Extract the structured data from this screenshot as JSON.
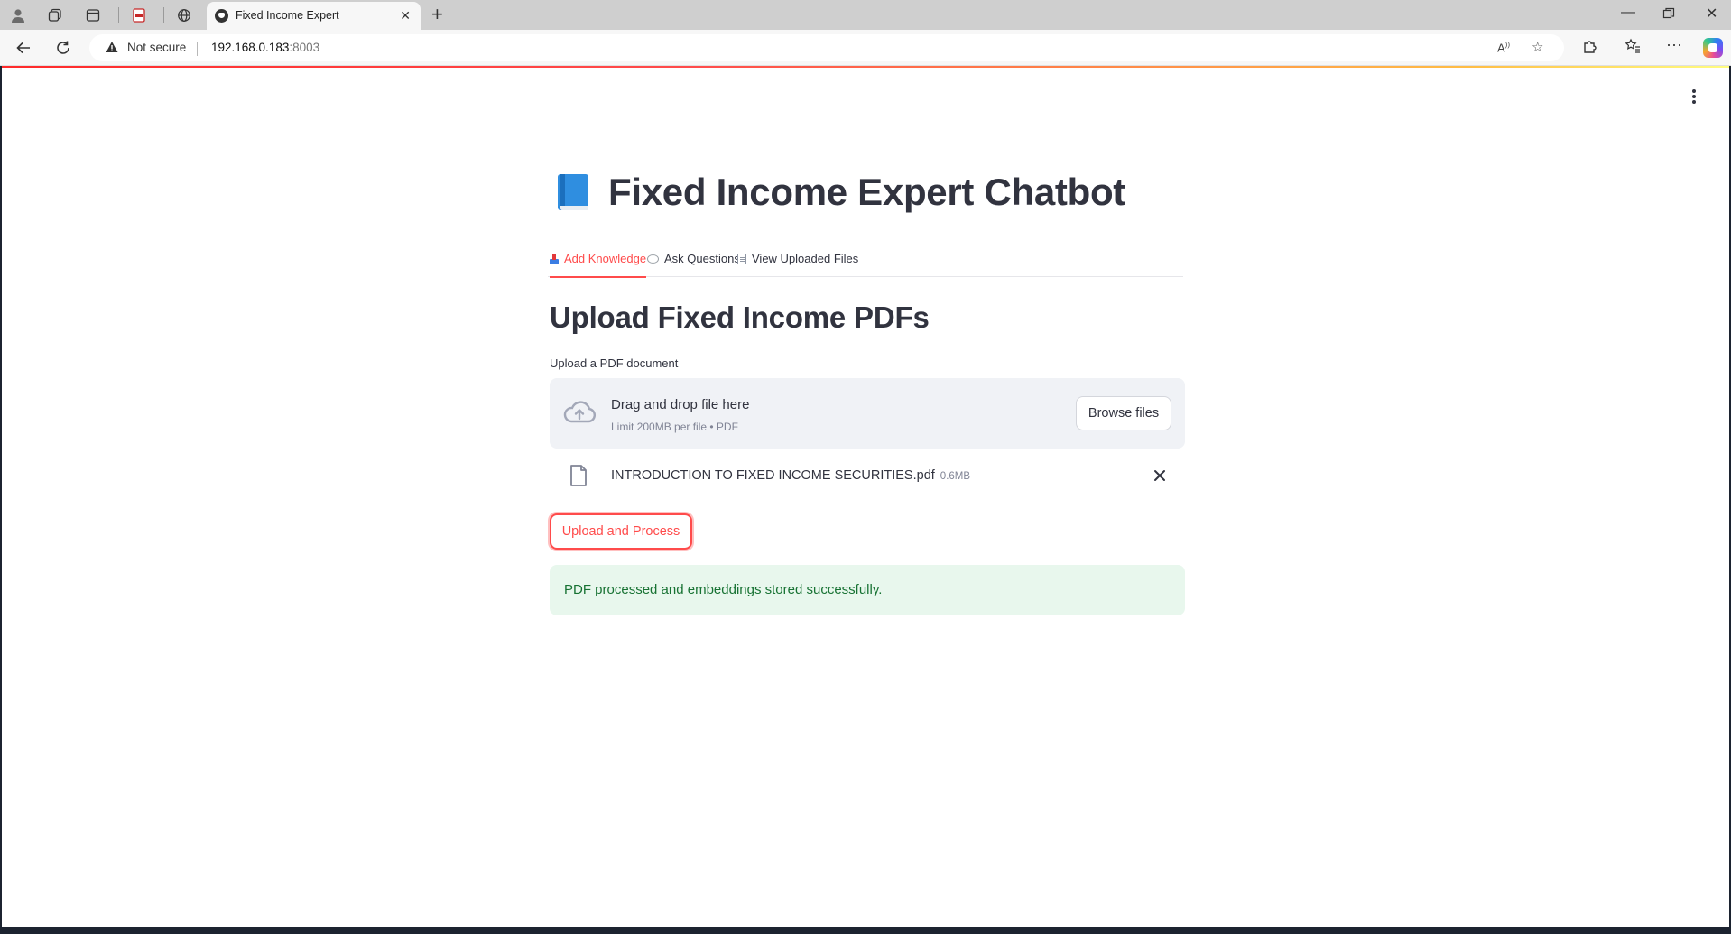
{
  "browser": {
    "tab_title": "Fixed Income Expert",
    "security_label": "Not secure",
    "url_host": "192.168.0.183",
    "url_port": ":8003"
  },
  "app": {
    "title": "Fixed Income Expert Chatbot",
    "title_icon": "blue-book-icon",
    "tabs": [
      {
        "label": "Add Knowledge",
        "icon": "inbox-tray-icon",
        "active": true
      },
      {
        "label": "Ask Questions",
        "icon": "speech-bubble-icon",
        "active": false
      },
      {
        "label": "View Uploaded Files",
        "icon": "document-icon",
        "active": false
      }
    ],
    "accent_color": "#ff4b4b"
  },
  "upload": {
    "heading": "Upload Fixed Income PDFs",
    "label": "Upload a PDF document",
    "drop_text": "Drag and drop file here",
    "limit_text": "Limit 200MB per file • PDF",
    "browse_label": "Browse files",
    "file": {
      "name": "INTRODUCTION TO FIXED INCOME SECURITIES.pdf",
      "size": "0.6MB"
    },
    "process_label": "Upload and Process"
  },
  "status": {
    "message": "PDF processed and embeddings stored successfully.",
    "color": "#177233"
  }
}
